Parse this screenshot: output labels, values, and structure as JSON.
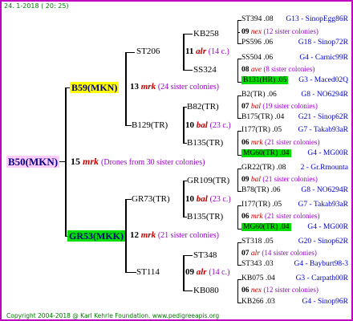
{
  "header": "24.  1-2018 ( 20: 25)",
  "footer": "Copyright 2004-2018 @ Karl Kehrle Foundation.   www.pedigreeapis.org",
  "root": {
    "name": "B50(MKN)",
    "year": "15",
    "mark": "mrk",
    "note": "(Drones from 30 sister colonies)"
  },
  "sire": {
    "name": "B59(MKN)",
    "year": "13",
    "mark": "mrk",
    "note": "(24 sister colonies)"
  },
  "dam": {
    "name": "GR53(MKK)",
    "year": "12",
    "mark": "mrk",
    "note": "(21 sister colonies)"
  },
  "g2": [
    {
      "name": "ST206",
      "year": "11",
      "mark": "alr",
      "note": "(14 c.)"
    },
    {
      "name": "B129(TR)",
      "year": "10",
      "mark": "bal",
      "note": "(23 c.)"
    },
    {
      "name": "GR73(TR)",
      "year": "10",
      "mark": "bal",
      "note": "(23 c.)"
    },
    {
      "name": "ST114",
      "year": "09",
      "mark": "alr",
      "note": "(14 c.)"
    }
  ],
  "g3": [
    {
      "name": "KB258"
    },
    {
      "name": "SS324"
    },
    {
      "name": "B82(TR)"
    },
    {
      "name": "B135(TR)"
    },
    {
      "name": "GR109(TR)"
    },
    {
      "name": "B135(TR)"
    },
    {
      "name": "ST348"
    },
    {
      "name": "KB080"
    }
  ],
  "g4": [
    {
      "kind": "sire",
      "name": "ST394 .08",
      "origin": "G13 - SinopEgg86R"
    },
    {
      "kind": "mate",
      "year": "09",
      "mark": "nex",
      "note": "(12 sister colonies)"
    },
    {
      "kind": "dam",
      "name": "PS596 .06",
      "origin": "G18 - Sinop72R"
    },
    {
      "kind": "sire",
      "name": "SS504 .06",
      "origin": "G4 - Carnic99R"
    },
    {
      "kind": "mate",
      "year": "08",
      "mark": "ave",
      "note": "(8 sister colonies)"
    },
    {
      "kind": "dam",
      "name": "B131(HR) .05",
      "origin": "G3 - Maced02Q",
      "hl": "green"
    },
    {
      "kind": "sire",
      "name": "B2(TR) .06",
      "origin": "G8 - NO6294R"
    },
    {
      "kind": "mate",
      "year": "07",
      "mark": "bal",
      "note": "(19 sister colonies)"
    },
    {
      "kind": "dam",
      "name": "B175(TR) .04",
      "origin": "G21 - Sinop62R"
    },
    {
      "kind": "sire",
      "name": "I177(TR) .05",
      "origin": "G7 - Takab93aR"
    },
    {
      "kind": "mate",
      "year": "06",
      "mark": "mrk",
      "note": "(21 sister colonies)"
    },
    {
      "kind": "dam",
      "name": "MG60(TR) .04",
      "origin": "G4 - MG00R",
      "hl": "green"
    },
    {
      "kind": "sire",
      "name": "GR22(TR) .08",
      "origin": "2 - Gr.Rmounta"
    },
    {
      "kind": "mate",
      "year": "09",
      "mark": "bal",
      "note": "(21 sister colonies)"
    },
    {
      "kind": "dam",
      "name": "B78(TR) .06",
      "origin": "G8 - NO6294R"
    },
    {
      "kind": "sire",
      "name": "I177(TR) .05",
      "origin": "G7 - Takab93aR"
    },
    {
      "kind": "mate",
      "year": "06",
      "mark": "mrk",
      "note": "(21 sister colonies)"
    },
    {
      "kind": "dam",
      "name": "MG60(TR) .04",
      "origin": "G4 - MG00R",
      "hl": "green"
    },
    {
      "kind": "sire",
      "name": "ST318 .05",
      "origin": "G20 - Sinop62R"
    },
    {
      "kind": "mate",
      "year": "07",
      "mark": "alr",
      "note": "(14 sister colonies)"
    },
    {
      "kind": "dam",
      "name": "ST343 .03",
      "origin": "G4 - Bayburt98-3"
    },
    {
      "kind": "sire",
      "name": "KB075 .04",
      "origin": "G3 - Carpath00R"
    },
    {
      "kind": "mate",
      "year": "06",
      "mark": "nex",
      "note": "(12 sister colonies)"
    },
    {
      "kind": "dam",
      "name": "KB266 .03",
      "origin": "G4 - Sinop96R"
    }
  ]
}
